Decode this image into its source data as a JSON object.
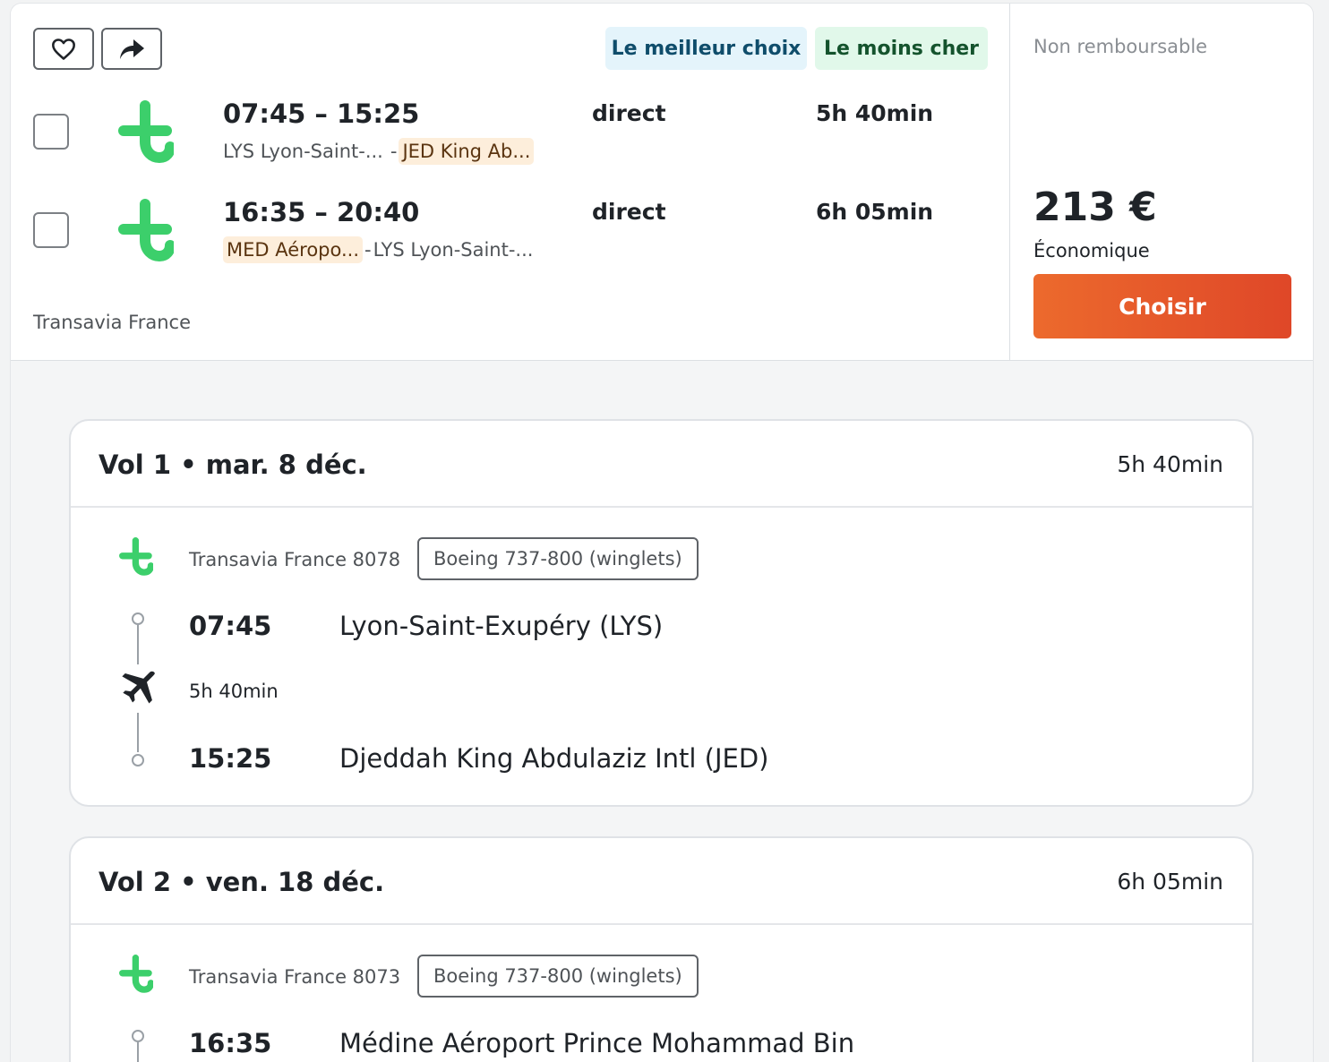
{
  "colors": {
    "brand_green": "#3ccf6b",
    "accent_orange": "#e65a2b"
  },
  "actions": {
    "favorite_icon": "heart-icon",
    "share_icon": "share-arrow-icon"
  },
  "badges": {
    "best": "Le meilleur choix",
    "cheapest": "Le moins cher"
  },
  "legs": [
    {
      "times": "07:45 – 15:25",
      "from": "LYS Lyon-Saint-...",
      "sep": "-",
      "to": "JED King Ab...",
      "stops": "direct",
      "duration": "5h 40min"
    },
    {
      "times": "16:35 – 20:40",
      "from": "MED Aéropo...",
      "sep": "-",
      "to": "LYS Lyon-Saint-...",
      "stops": "direct",
      "duration": "6h 05min"
    }
  ],
  "carrier": "Transavia France",
  "fare": {
    "refund": "Non remboursable",
    "price": "213 €",
    "class": "Économique",
    "choose_label": "Choisir"
  },
  "flights": [
    {
      "title": "Vol 1 • mar. 8 déc.",
      "duration": "5h 40min",
      "flight_number": "Transavia France 8078",
      "aircraft": "Boeing 737-800 (winglets)",
      "dep_time": "07:45",
      "dep_airport": "Lyon-Saint-Exupéry (LYS)",
      "leg_duration": "5h 40min",
      "arr_time": "15:25",
      "arr_airport": "Djeddah King Abdulaziz Intl (JED)"
    },
    {
      "title": "Vol 2 • ven. 18 déc.",
      "duration": "6h 05min",
      "flight_number": "Transavia France 8073",
      "aircraft": "Boeing 737-800 (winglets)",
      "dep_time": "16:35",
      "dep_airport": "Médine Aéroport Prince Mohammad Bin"
    }
  ]
}
